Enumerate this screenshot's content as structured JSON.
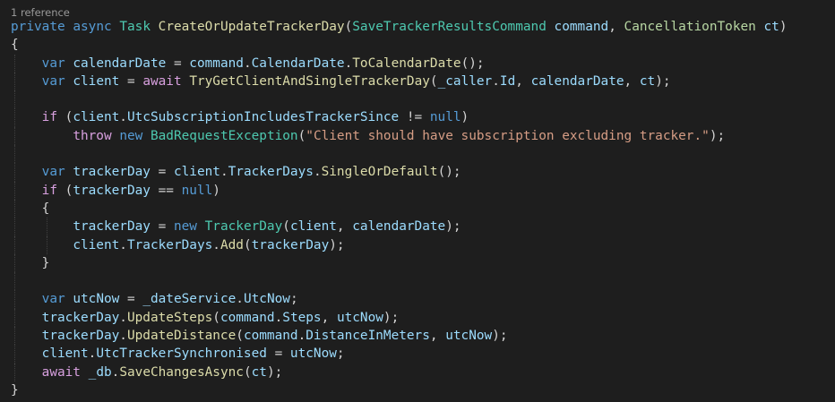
{
  "codelens": {
    "text": "1 reference"
  },
  "colors": {
    "background": "#1e1e1e",
    "keyword": "#569cd6",
    "control": "#d8a0df",
    "type": "#4ec9b0",
    "method": "#dcdcaa",
    "variable": "#9cdcfe",
    "string": "#d69d85",
    "codelens": "#999999"
  },
  "lines": [
    [
      {
        "t": "private",
        "c": "kw"
      },
      {
        "t": " ",
        "c": "pun"
      },
      {
        "t": "async",
        "c": "kw"
      },
      {
        "t": " ",
        "c": "pun"
      },
      {
        "t": "Task",
        "c": "typ"
      },
      {
        "t": " ",
        "c": "pun"
      },
      {
        "t": "CreateOrUpdateTrackerDay",
        "c": "fn"
      },
      {
        "t": "(",
        "c": "pun"
      },
      {
        "t": "SaveTrackerResultsCommand",
        "c": "typ"
      },
      {
        "t": " ",
        "c": "pun"
      },
      {
        "t": "command",
        "c": "var"
      },
      {
        "t": ", ",
        "c": "pun"
      },
      {
        "t": "CancellationToken",
        "c": "typi"
      },
      {
        "t": " ",
        "c": "pun"
      },
      {
        "t": "ct",
        "c": "var"
      },
      {
        "t": ")",
        "c": "pun"
      }
    ],
    [
      {
        "t": "{",
        "c": "pun"
      }
    ],
    [
      {
        "t": "    ",
        "c": "pun"
      },
      {
        "t": "var",
        "c": "kw"
      },
      {
        "t": " ",
        "c": "pun"
      },
      {
        "t": "calendarDate",
        "c": "var"
      },
      {
        "t": " = ",
        "c": "pun"
      },
      {
        "t": "command",
        "c": "var"
      },
      {
        "t": ".",
        "c": "pun"
      },
      {
        "t": "CalendarDate",
        "c": "var"
      },
      {
        "t": ".",
        "c": "pun"
      },
      {
        "t": "ToCalendarDate",
        "c": "fn"
      },
      {
        "t": "();",
        "c": "pun"
      }
    ],
    [
      {
        "t": "    ",
        "c": "pun"
      },
      {
        "t": "var",
        "c": "kw"
      },
      {
        "t": " ",
        "c": "pun"
      },
      {
        "t": "client",
        "c": "var"
      },
      {
        "t": " = ",
        "c": "pun"
      },
      {
        "t": "await",
        "c": "ctl"
      },
      {
        "t": " ",
        "c": "pun"
      },
      {
        "t": "TryGetClientAndSingleTrackerDay",
        "c": "fn"
      },
      {
        "t": "(",
        "c": "pun"
      },
      {
        "t": "_caller",
        "c": "var"
      },
      {
        "t": ".",
        "c": "pun"
      },
      {
        "t": "Id",
        "c": "var"
      },
      {
        "t": ", ",
        "c": "pun"
      },
      {
        "t": "calendarDate",
        "c": "var"
      },
      {
        "t": ", ",
        "c": "pun"
      },
      {
        "t": "ct",
        "c": "var"
      },
      {
        "t": ");",
        "c": "pun"
      }
    ],
    [],
    [
      {
        "t": "    ",
        "c": "pun"
      },
      {
        "t": "if",
        "c": "ctl"
      },
      {
        "t": " (",
        "c": "pun"
      },
      {
        "t": "client",
        "c": "var"
      },
      {
        "t": ".",
        "c": "pun"
      },
      {
        "t": "UtcSubscriptionIncludesTrackerSince",
        "c": "var"
      },
      {
        "t": " != ",
        "c": "pun"
      },
      {
        "t": "null",
        "c": "kw"
      },
      {
        "t": ")",
        "c": "pun"
      }
    ],
    [
      {
        "t": "        ",
        "c": "pun"
      },
      {
        "t": "throw",
        "c": "ctl"
      },
      {
        "t": " ",
        "c": "pun"
      },
      {
        "t": "new",
        "c": "kw"
      },
      {
        "t": " ",
        "c": "pun"
      },
      {
        "t": "BadRequestException",
        "c": "typ"
      },
      {
        "t": "(",
        "c": "pun"
      },
      {
        "t": "\"Client should have subscription excluding tracker.\"",
        "c": "str"
      },
      {
        "t": ");",
        "c": "pun"
      }
    ],
    [],
    [
      {
        "t": "    ",
        "c": "pun"
      },
      {
        "t": "var",
        "c": "kw"
      },
      {
        "t": " ",
        "c": "pun"
      },
      {
        "t": "trackerDay",
        "c": "var"
      },
      {
        "t": " = ",
        "c": "pun"
      },
      {
        "t": "client",
        "c": "var"
      },
      {
        "t": ".",
        "c": "pun"
      },
      {
        "t": "TrackerDays",
        "c": "var"
      },
      {
        "t": ".",
        "c": "pun"
      },
      {
        "t": "SingleOrDefault",
        "c": "fn"
      },
      {
        "t": "();",
        "c": "pun"
      }
    ],
    [
      {
        "t": "    ",
        "c": "pun"
      },
      {
        "t": "if",
        "c": "ctl"
      },
      {
        "t": " (",
        "c": "pun"
      },
      {
        "t": "trackerDay",
        "c": "var"
      },
      {
        "t": " == ",
        "c": "pun"
      },
      {
        "t": "null",
        "c": "kw"
      },
      {
        "t": ")",
        "c": "pun"
      }
    ],
    [
      {
        "t": "    ",
        "c": "pun"
      },
      {
        "t": "{",
        "c": "pun"
      }
    ],
    [
      {
        "t": "        ",
        "c": "pun"
      },
      {
        "t": "trackerDay",
        "c": "var"
      },
      {
        "t": " = ",
        "c": "pun"
      },
      {
        "t": "new",
        "c": "kw"
      },
      {
        "t": " ",
        "c": "pun"
      },
      {
        "t": "TrackerDay",
        "c": "typ"
      },
      {
        "t": "(",
        "c": "pun"
      },
      {
        "t": "client",
        "c": "var"
      },
      {
        "t": ", ",
        "c": "pun"
      },
      {
        "t": "calendarDate",
        "c": "var"
      },
      {
        "t": ");",
        "c": "pun"
      }
    ],
    [
      {
        "t": "        ",
        "c": "pun"
      },
      {
        "t": "client",
        "c": "var"
      },
      {
        "t": ".",
        "c": "pun"
      },
      {
        "t": "TrackerDays",
        "c": "var"
      },
      {
        "t": ".",
        "c": "pun"
      },
      {
        "t": "Add",
        "c": "fn"
      },
      {
        "t": "(",
        "c": "pun"
      },
      {
        "t": "trackerDay",
        "c": "var"
      },
      {
        "t": ");",
        "c": "pun"
      }
    ],
    [
      {
        "t": "    ",
        "c": "pun"
      },
      {
        "t": "}",
        "c": "pun"
      }
    ],
    [],
    [
      {
        "t": "    ",
        "c": "pun"
      },
      {
        "t": "var",
        "c": "kw"
      },
      {
        "t": " ",
        "c": "pun"
      },
      {
        "t": "utcNow",
        "c": "var"
      },
      {
        "t": " = ",
        "c": "pun"
      },
      {
        "t": "_dateService",
        "c": "var"
      },
      {
        "t": ".",
        "c": "pun"
      },
      {
        "t": "UtcNow",
        "c": "var"
      },
      {
        "t": ";",
        "c": "pun"
      }
    ],
    [
      {
        "t": "    ",
        "c": "pun"
      },
      {
        "t": "trackerDay",
        "c": "var"
      },
      {
        "t": ".",
        "c": "pun"
      },
      {
        "t": "UpdateSteps",
        "c": "fn"
      },
      {
        "t": "(",
        "c": "pun"
      },
      {
        "t": "command",
        "c": "var"
      },
      {
        "t": ".",
        "c": "pun"
      },
      {
        "t": "Steps",
        "c": "var"
      },
      {
        "t": ", ",
        "c": "pun"
      },
      {
        "t": "utcNow",
        "c": "var"
      },
      {
        "t": ");",
        "c": "pun"
      }
    ],
    [
      {
        "t": "    ",
        "c": "pun"
      },
      {
        "t": "trackerDay",
        "c": "var"
      },
      {
        "t": ".",
        "c": "pun"
      },
      {
        "t": "UpdateDistance",
        "c": "fn"
      },
      {
        "t": "(",
        "c": "pun"
      },
      {
        "t": "command",
        "c": "var"
      },
      {
        "t": ".",
        "c": "pun"
      },
      {
        "t": "DistanceInMeters",
        "c": "var"
      },
      {
        "t": ", ",
        "c": "pun"
      },
      {
        "t": "utcNow",
        "c": "var"
      },
      {
        "t": ");",
        "c": "pun"
      }
    ],
    [
      {
        "t": "    ",
        "c": "pun"
      },
      {
        "t": "client",
        "c": "var"
      },
      {
        "t": ".",
        "c": "pun"
      },
      {
        "t": "UtcTrackerSynchronised",
        "c": "var"
      },
      {
        "t": " = ",
        "c": "pun"
      },
      {
        "t": "utcNow",
        "c": "var"
      },
      {
        "t": ";",
        "c": "pun"
      }
    ],
    [
      {
        "t": "    ",
        "c": "pun"
      },
      {
        "t": "await",
        "c": "ctl"
      },
      {
        "t": " ",
        "c": "pun"
      },
      {
        "t": "_db",
        "c": "var"
      },
      {
        "t": ".",
        "c": "pun"
      },
      {
        "t": "SaveChangesAsync",
        "c": "fn"
      },
      {
        "t": "(",
        "c": "pun"
      },
      {
        "t": "ct",
        "c": "var"
      },
      {
        "t": ");",
        "c": "pun"
      }
    ],
    [
      {
        "t": "}",
        "c": "pun"
      }
    ]
  ]
}
